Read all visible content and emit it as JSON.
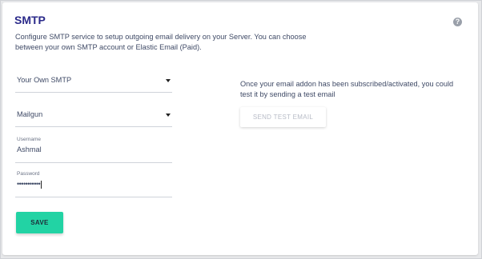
{
  "section": {
    "title": "SMTP",
    "help_icon": "?",
    "description": "Configure SMTP service to setup outgoing email delivery on your Server. You can choose between your own SMTP account or Elastic Email (Paid)."
  },
  "form": {
    "smtp_type": {
      "selected": "Your Own SMTP"
    },
    "provider": {
      "selected": "Mailgun"
    },
    "username": {
      "label": "Username",
      "value": "Ashmal"
    },
    "password": {
      "label": "Password",
      "masked_value": "•••••••••••"
    },
    "save_label": "SAVE"
  },
  "test_panel": {
    "info": "Once your email addon has been subscribed/activated, you could test it by sending a test email",
    "send_test_label": "SEND TEST EMAIL"
  },
  "colors": {
    "title": "#2b2a8a",
    "save_button": "#22d3a4",
    "text": "#3f4a66",
    "disabled_text": "#b8bcc7"
  },
  "icons": {
    "help": "question-circle-icon",
    "dropdown": "caret-down-icon"
  }
}
